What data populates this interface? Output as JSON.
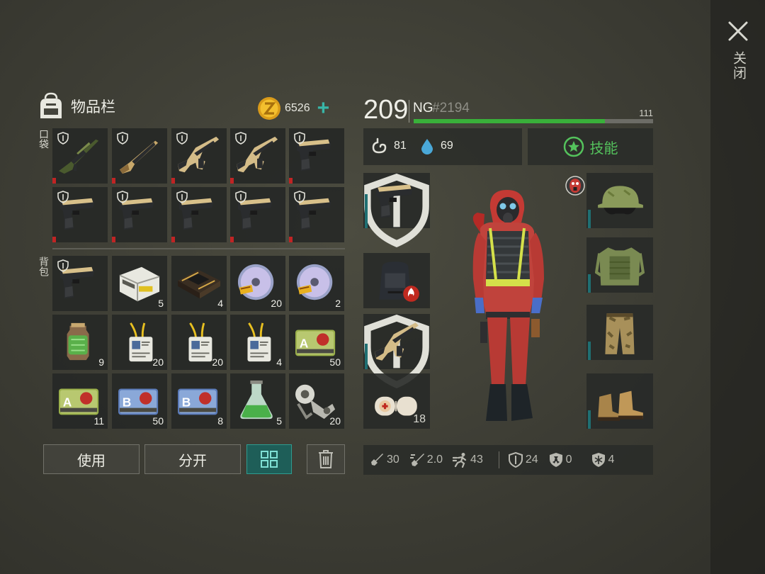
{
  "close": {
    "label": "关闭",
    "icon": "close-icon"
  },
  "inventory": {
    "title": "物品栏",
    "icon": "backpack-icon",
    "coins": "6526",
    "coin_icon": "coin-icon",
    "add_icon": "plus-icon",
    "pocket_label": "口袋",
    "backpack_label": "背包"
  },
  "pockets": [
    {
      "item": "sniper-rifle",
      "count": ""
    },
    {
      "item": "shotgun",
      "count": ""
    },
    {
      "item": "assault-rifle",
      "count": ""
    },
    {
      "item": "assault-rifle",
      "count": ""
    },
    {
      "item": "pistol",
      "count": ""
    },
    {
      "item": "pistol",
      "count": ""
    },
    {
      "item": "pistol",
      "count": ""
    },
    {
      "item": "pistol",
      "count": ""
    },
    {
      "item": "pistol",
      "count": ""
    },
    {
      "item": "pistol",
      "count": ""
    }
  ],
  "backpack": [
    {
      "item": "pistol",
      "count": ""
    },
    {
      "item": "circuit-box",
      "count": "5"
    },
    {
      "item": "chip-board",
      "count": "4"
    },
    {
      "item": "cd-disc",
      "count": "20"
    },
    {
      "item": "cd-disc",
      "count": "2"
    },
    {
      "item": "canister",
      "count": "9"
    },
    {
      "item": "id-badge",
      "count": "20"
    },
    {
      "item": "id-badge",
      "count": "20"
    },
    {
      "item": "id-badge",
      "count": "4"
    },
    {
      "item": "sector-a-card",
      "count": "50"
    },
    {
      "item": "sector-a-card",
      "count": "11"
    },
    {
      "item": "sector-b-card",
      "count": "50"
    },
    {
      "item": "sector-b-card",
      "count": "8"
    },
    {
      "item": "flask",
      "count": "5"
    },
    {
      "item": "machine-part",
      "count": "20"
    }
  ],
  "actions": {
    "use": "使用",
    "split": "分开",
    "sort_icon": "grid-sort-icon",
    "trash_icon": "trash-icon"
  },
  "player": {
    "level": "209",
    "name": "NG",
    "tag": "#2194",
    "xp_label": "111",
    "xp_fraction": 0.8
  },
  "vitals": {
    "hunger": "81",
    "water": "69",
    "hunger_icon": "stomach-icon",
    "water_icon": "water-drop-icon"
  },
  "skills": {
    "label": "技能",
    "icon": "star-icon"
  },
  "equipment": {
    "left": [
      {
        "item": "pistol",
        "count": ""
      },
      {
        "item": "backpack-fire",
        "count": ""
      },
      {
        "item": "assault-rifle",
        "count": ""
      },
      {
        "item": "bandage",
        "count": "18"
      }
    ],
    "right": [
      {
        "item": "helmet-goggles"
      },
      {
        "item": "armor-vest"
      },
      {
        "item": "camo-pants"
      },
      {
        "item": "boots"
      }
    ],
    "status_icon": "gas-mask-icon"
  },
  "stats": [
    {
      "icon": "melee-damage-icon",
      "value": "30"
    },
    {
      "icon": "attack-speed-icon",
      "value": "2.0"
    },
    {
      "icon": "speed-icon",
      "value": "43"
    },
    {
      "icon": "armor-icon",
      "value": "24"
    },
    {
      "icon": "radiation-icon",
      "value": "0"
    },
    {
      "icon": "cold-resist-icon",
      "value": "4"
    }
  ]
}
